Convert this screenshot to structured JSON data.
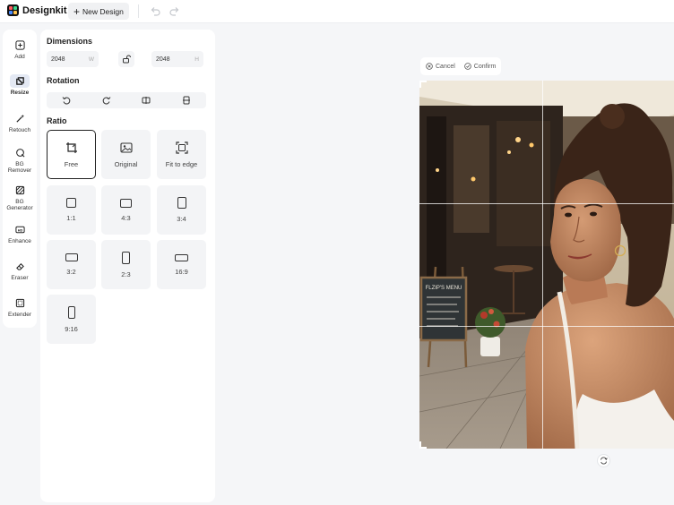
{
  "app": {
    "name": "Designkit",
    "new_design_label": "New Design",
    "logo_colors": [
      "#ff5a5f",
      "#3dd68c",
      "#4b8bff",
      "#ffc34d"
    ]
  },
  "tools": [
    {
      "label": "Add",
      "icon": "add-square-icon"
    },
    {
      "label": "Resize",
      "icon": "resize-icon",
      "active": true
    },
    {
      "label": "Retouch",
      "icon": "magic-wand-icon"
    },
    {
      "label": "BG Remover",
      "icon": "bg-remover-icon"
    },
    {
      "label": "BG Generator",
      "icon": "bg-generator-icon"
    },
    {
      "label": "Enhance",
      "icon": "hd-icon"
    },
    {
      "label": "Eraser",
      "icon": "eraser-icon"
    },
    {
      "label": "Extender",
      "icon": "extender-icon"
    }
  ],
  "panel": {
    "dimensions_title": "Dimensions",
    "width_value": "2048",
    "width_unit": "W",
    "height_value": "2048",
    "height_unit": "H",
    "rotation_title": "Rotation",
    "ratio_title": "Ratio",
    "ratios": [
      {
        "label": "Free",
        "icon": "free-crop-icon",
        "selected": true
      },
      {
        "label": "Original",
        "icon": "image-icon"
      },
      {
        "label": "Fit to edge",
        "icon": "fit-edge-icon"
      },
      {
        "label": "1:1",
        "icon": "ratio-1-1-icon"
      },
      {
        "label": "4:3",
        "icon": "ratio-4-3-icon"
      },
      {
        "label": "3:4",
        "icon": "ratio-3-4-icon"
      },
      {
        "label": "3:2",
        "icon": "ratio-3-2-icon"
      },
      {
        "label": "2:3",
        "icon": "ratio-2-3-icon"
      },
      {
        "label": "16:9",
        "icon": "ratio-16-9-icon"
      },
      {
        "label": "9:16",
        "icon": "ratio-9-16-icon"
      }
    ]
  },
  "canvas": {
    "cancel_label": "Cancel",
    "confirm_label": "Confirm",
    "chalkboard_text": "FLZIP'S MENU"
  }
}
